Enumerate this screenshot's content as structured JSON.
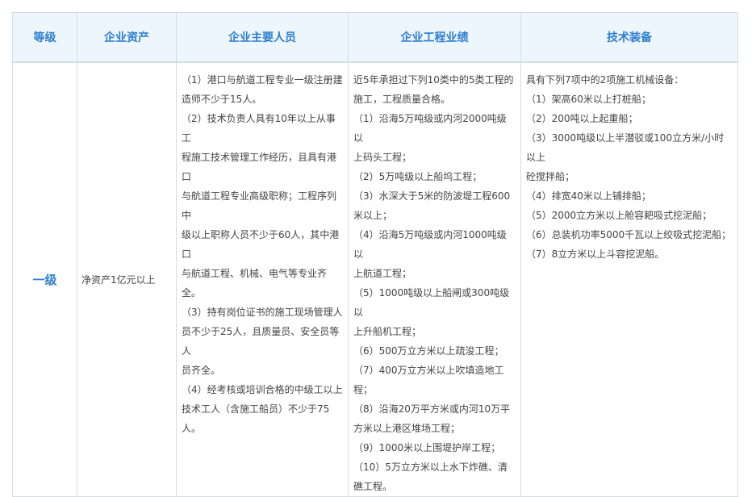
{
  "headers": {
    "grade": "等级",
    "assets": "企业资产",
    "personnel": "企业主要人员",
    "performance": "企业工程业绩",
    "equipment": "技术装备"
  },
  "row": {
    "grade": "一级",
    "assets": "净资产1亿元以上",
    "personnel": [
      "（1）港口与航道工程专业一级注册建",
      "造师不少于15人。",
      "（2）技术负责人具有10年以上从事工",
      "程施工技术管理工作经历，且具有港口",
      "与航道工程专业高级职称；工程序列中",
      "级以上职称人员不少于60人，其中港口",
      "与航道工程、机械、电气等专业齐全。",
      "（3）持有岗位证书的施工现场管理人",
      "员不少于25人，且质量员、安全员等人",
      "员齐全。",
      "（4）经考核或培训合格的中级工以上",
      "技术工人（含施工船员）不少于75人。"
    ],
    "performance": [
      "近5年承担过下列10类中的5类工程的",
      "施工，工程质量合格。",
      "（1）沿海5万吨级或内河2000吨级以",
      "上码头工程；",
      "（2）5万吨级以上船坞工程；",
      "（3）水深大于5米的防波堤工程600",
      "米以上；",
      "（4）沿海5万吨级或内河1000吨级以",
      "上航道工程；",
      "（5）1000吨级以上船闸或300吨级以",
      "上升船机工程；",
      "（6）500万立方米以上疏浚工程；",
      "（7）400万立方米以上吹填造地工",
      "程；",
      "（8）沿海20万平方米或内河10万平",
      "方米以上港区堆场工程；",
      "（9）1000米以上围堤护岸工程；",
      "（10）5万立方米以上水下炸礁、清",
      "礁工程。"
    ],
    "equipment": [
      "具有下列7项中的2项施工机械设备：",
      "（1）架高60米以上打桩船；",
      "（2）200吨以上起重船；",
      "（3）3000吨级以上半潜驳或100立方米/小时以上",
      "砼搅拌船；",
      "（4）排宽40米以上铺排船；",
      "（5）2000立方米以上舱容耙吸式挖泥船；",
      "（6）总装机功率5000千瓦以上绞吸式挖泥船；",
      "（7）8立方米以上斗容挖泥船。"
    ]
  }
}
